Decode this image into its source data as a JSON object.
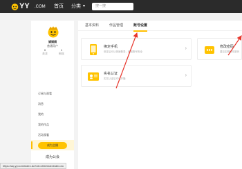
{
  "topbar": {
    "logo_text": "YY",
    "logo_suffix": ".COM",
    "nav": {
      "home": "首页",
      "category": "分类"
    },
    "search_placeholder": "搜一搜"
  },
  "profile": {
    "name": "娟娟娟",
    "level": "普通用户",
    "stats": [
      {
        "value": "0",
        "label": "关注"
      },
      {
        "value": "1",
        "label": "粉丝"
      }
    ],
    "menu": [
      {
        "label": "订阅与观看",
        "active": false
      },
      {
        "label": "消息",
        "active": false
      },
      {
        "label": "我的",
        "active": false
      },
      {
        "label": "我的作品",
        "active": false
      },
      {
        "label": "活动观看",
        "active": false
      },
      {
        "label": "基本资料",
        "active": true
      }
    ],
    "upgrade_button": "成为主播",
    "become_link": "成为公会"
  },
  "tabs": [
    {
      "label": "基本资料"
    },
    {
      "label": "作品管理"
    },
    {
      "label": "账号设置",
      "active": true
    }
  ],
  "cards": {
    "phone": {
      "title": "绑定手机",
      "desc": "绑定后可以快速登录，增加账号安全"
    },
    "real": {
      "title": "实名认证",
      "desc": "实名认证后可以开播"
    },
    "password": {
      "title": "修改密码",
      "desc": "建议定期修改密码"
    }
  },
  "status_url": "https://aq.yy.com/index.do?ob=vhtb/mob/index.do",
  "colors": {
    "accent": "#ffbe00",
    "arrow": "#e8362c",
    "topbar": "#2b2b2b"
  }
}
